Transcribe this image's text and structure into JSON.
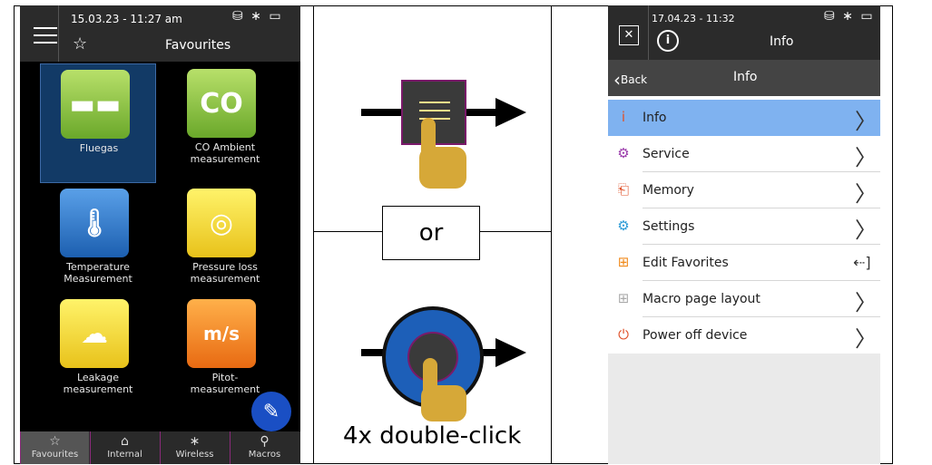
{
  "left_device": {
    "status_time": "15.03.23 - 11:27 am",
    "status_icons": "⛁ ∗ ▭",
    "title": "Favourites",
    "menu_icon": "hamburger-icon",
    "star_icon": "star-icon",
    "tiles": [
      {
        "label1": "Fluegas",
        "label2": "",
        "color": "#8cc63f",
        "glyph": "▬▬"
      },
      {
        "label1": "CO Ambient",
        "label2": "measurement",
        "color": "#8cc63f",
        "glyph": "CO"
      },
      {
        "label1": "Temperature",
        "label2": "Measurement",
        "color": "#2d7fd4",
        "glyph": "🌡"
      },
      {
        "label1": "Pressure loss",
        "label2": "measurement",
        "color": "#f5d90a",
        "glyph": "◎"
      },
      {
        "label1": "Leakage",
        "label2": "measurement",
        "color": "#f5d90a",
        "glyph": "☁"
      },
      {
        "label1": "Pitot-",
        "label2": "measurement",
        "color": "#f08a1a",
        "glyph": "m/s"
      }
    ],
    "fab_icon": "edit-icon",
    "bottom_nav": [
      {
        "label": "Favourites",
        "icon": "☆"
      },
      {
        "label": "Internal",
        "icon": "⌂"
      },
      {
        "label": "Wireless",
        "icon": "∗"
      },
      {
        "label": "Macros",
        "icon": "⚲"
      }
    ]
  },
  "middle": {
    "or_text": "or",
    "double_click_text": "4x double-click",
    "hand_color": "#d6a838",
    "knob_color": "#1d5fb8"
  },
  "right_device": {
    "status_time": "17.04.23 - 11:32",
    "status_icons": "⛁ ∗ ▭",
    "close_glyph": "✕",
    "info_glyph": "i",
    "title": "Info",
    "back_label": "Back",
    "nav_title": "Info",
    "menu": [
      {
        "label": "Info",
        "icon": "ⅰ",
        "icon_color": "#e0522a",
        "selected": true,
        "trail": "〉"
      },
      {
        "label": "Service",
        "icon": "⚙",
        "icon_color": "#9a3aaa",
        "selected": false,
        "trail": "〉"
      },
      {
        "label": "Memory",
        "icon": "⎗",
        "icon_color": "#e0522a",
        "selected": false,
        "trail": "〉"
      },
      {
        "label": "Settings",
        "icon": "⚙",
        "icon_color": "#2a9ad6",
        "selected": false,
        "trail": "〉"
      },
      {
        "label": "Edit Favorites",
        "icon": "⊞",
        "icon_color": "#f08a1a",
        "selected": false,
        "trail": "⇠]"
      },
      {
        "label": "Macro page layout",
        "icon": "⊞",
        "icon_color": "#aaaaaa",
        "selected": false,
        "trail": "〉"
      },
      {
        "label": "Power off device",
        "icon": "⏻",
        "icon_color": "#e0522a",
        "selected": false,
        "trail": "〉"
      }
    ]
  }
}
